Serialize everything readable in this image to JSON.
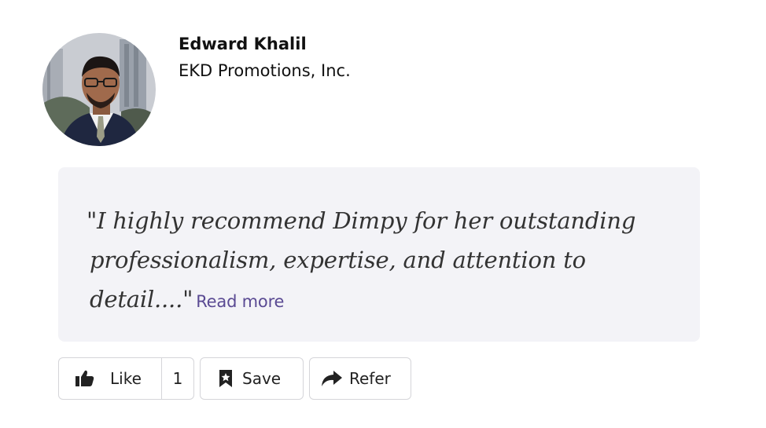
{
  "author": {
    "name": "Edward Khalil",
    "company": "EKD Promotions, Inc.",
    "avatar_icon": "person-photo"
  },
  "testimonial": {
    "line1": "\"I highly recommend Dimpy for her outstanding",
    "line2": "professionalism, expertise, and attention to",
    "line3": "detail....\"",
    "read_more": "Read more",
    "background": "#f3f3f7",
    "link_color": "#5a4a93"
  },
  "actions": {
    "like_label": "Like",
    "like_count": "1",
    "save_label": "Save",
    "refer_label": "Refer",
    "like_icon": "thumbs-up-icon",
    "save_icon": "bookmark-star-icon",
    "refer_icon": "share-arrow-icon"
  }
}
